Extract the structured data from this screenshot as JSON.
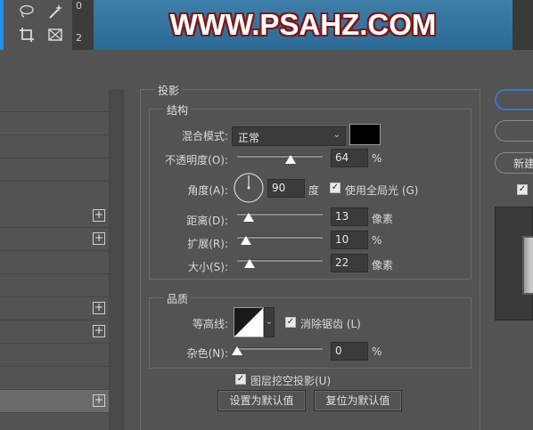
{
  "banner": {
    "text": "WWW.PSAHZ.COM"
  },
  "ruler": {
    "marks": [
      "0",
      "2"
    ]
  },
  "tools": [
    {
      "name": "lasso-icon"
    },
    {
      "name": "magic-wand-icon"
    },
    {
      "name": "crop-icon"
    },
    {
      "name": "frame-icon"
    }
  ],
  "dialog": {
    "title": "投影",
    "structure": {
      "title": "结构",
      "blend_mode_label": "混合模式:",
      "blend_mode_value": "正常",
      "shadow_color": "#000000",
      "opacity_label": "不透明度(O):",
      "opacity_value": "64",
      "opacity_unit": "%",
      "opacity_level": 0.64,
      "angle_label": "角度(A):",
      "angle_value": "90",
      "angle_unit": "度",
      "global_light_label": "使用全局光 (G)",
      "global_light_checked": true,
      "distance_label": "距离(D):",
      "distance_value": "13",
      "distance_unit": "像素",
      "spread_label": "扩展(R):",
      "spread_value": "10",
      "spread_unit": "%",
      "size_label": "大小(S):",
      "size_value": "22",
      "size_unit": "像素"
    },
    "quality": {
      "title": "品质",
      "contour_label": "等高线:",
      "antialias_label": "消除锯齿 (L)",
      "antialias_checked": true,
      "noise_label": "杂色(N):",
      "noise_value": "0",
      "noise_unit": "%"
    },
    "knockout_label": "图层挖空投影(U)",
    "knockout_checked": true,
    "make_default_label": "设置为默认值",
    "reset_default_label": "复位为默认值",
    "right": {
      "new_style_label": "新建",
      "preview_checked": true
    }
  },
  "colors": {
    "accent": "#3d73c9",
    "toolbar_accent": "#1f8fe8",
    "banner_bg": "#2a6a95",
    "banner_outline": "#7a1b1b"
  }
}
